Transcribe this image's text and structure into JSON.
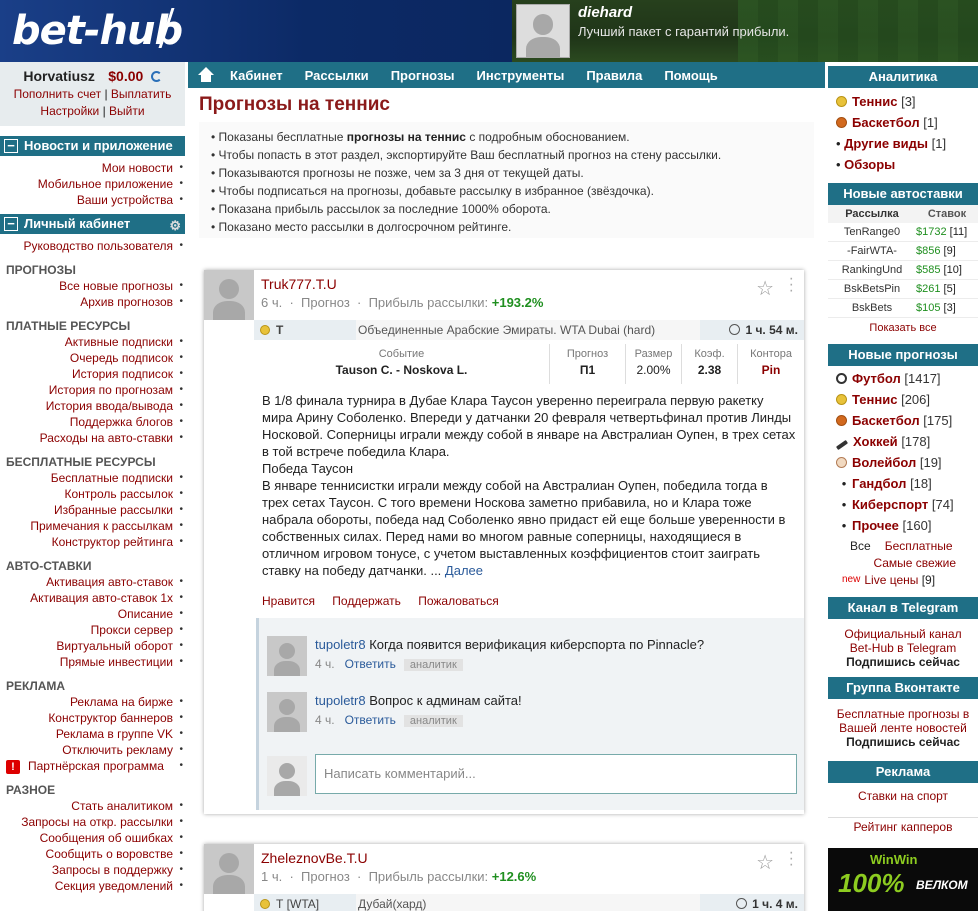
{
  "header": {
    "logo": "bet-hub",
    "promo_user": "diehard",
    "promo_slogan": "Лучший пакет с гарантий прибыли."
  },
  "account": {
    "username": "Horvatiusz",
    "balance": "$0.00",
    "links": [
      "Пополнить счет",
      "Выплатить",
      "Настройки",
      "Выйти"
    ]
  },
  "left": {
    "news_header": "Новости и приложение",
    "news_items": [
      "Мои новости",
      "Мобильное приложение",
      "Ваши устройства"
    ],
    "cabinet_header": "Личный кабинет",
    "guide": "Руководство пользователя",
    "sections": [
      {
        "title": "ПРОГНОЗЫ",
        "items": [
          "Все новые прогнозы",
          "Архив прогнозов"
        ]
      },
      {
        "title": "ПЛАТНЫЕ РЕСУРСЫ",
        "items": [
          "Активные подписки",
          "Очередь подписок",
          "История подписок",
          "История по прогнозам",
          "История ввода/вывода",
          "Поддержка блогов",
          "Расходы на авто-ставки"
        ]
      },
      {
        "title": "БЕСПЛАТНЫЕ РЕСУРСЫ",
        "items": [
          "Бесплатные подписки",
          "Контроль рассылок",
          "Избранные рассылки",
          "Примечания к рассылкам",
          "Конструктор рейтинга"
        ]
      },
      {
        "title": "АВТО-СТАВКИ",
        "items": [
          "Активация авто-ставок",
          "Активация авто-ставок 1х",
          "Описание",
          "Прокси сервер",
          "Виртуальный оборот",
          "Прямые инвестиции"
        ]
      },
      {
        "title": "РЕКЛАМА",
        "items": [
          "Реклама на бирже",
          "Конструктор баннеров",
          "Реклама в группе VK",
          "Отключить рекламу"
        ],
        "special": "Партнёрская программа"
      },
      {
        "title": "РАЗНОЕ",
        "items": [
          "Стать аналитиком",
          "Запросы на откр. рассылки",
          "Сообщения об ошибках",
          "Сообщить о воровстве",
          "Запросы в поддержку",
          "Секция уведомлений"
        ]
      }
    ]
  },
  "nav": [
    "Кабинет",
    "Рассылки",
    "Прогнозы",
    "Инструменты",
    "Правила",
    "Помощь"
  ],
  "page_title": "Прогнозы на теннис",
  "info": {
    "line1_pre": "Показаны бесплатные ",
    "line1_bold": "прогнозы на теннис",
    "line1_post": " с подробным обоснованием.",
    "lines": [
      "Чтобы попасть в этот раздел, экспортируйте Ваш бесплатный прогноз на стену рассылки.",
      "Показываются прогнозы не позже, чем за 3 дня от текущей даты.",
      "Чтобы подписаться на прогнозы, добавьте рассылку в избранное (звёздочка).",
      "Показана прибыль рассылок за последние 1000% оборота.",
      "Показано место рассылки в долгосрочном рейтинге."
    ]
  },
  "posts": [
    {
      "author": "Truk777.T.U",
      "age": "6 ч.",
      "kind": "Прогноз",
      "profit_label": "Прибыль рассылки:",
      "profit": "+193.2%",
      "sport": "Т",
      "tournament": "Объединенные Арабские Эмираты. WTA Dubai (hard)",
      "time_left": "1 ч. 54 м.",
      "bet": {
        "event_label": "Событие",
        "event": "Tauson C. - Noskova L.",
        "pick_label": "Прогноз",
        "pick": "П1",
        "size_label": "Размер",
        "size": "2.00%",
        "odds_label": "Коэф.",
        "odds": "2.38",
        "book_label": "Контора",
        "book": "Pin"
      },
      "text": [
        "В 1/8 финала турнира в Дубае Клара Таусон уверенно переиграла первую ракетку мира Арину Соболенко. Впереди у датчанки 20 февраля четвертьфинал против Линды Носковой. Соперницы играли между собой в январе на Австралиан Оупен, в трех сетах в той встрече победила Клара.",
        "Победа Таусон",
        "В январе теннисистки играли между собой на Австралиан Оупен, победила тогда в трех сетах Таусон. С того времени Носкова заметно прибавила, но и Клара тоже набрала обороты, победа над Соболенко явно придаст ей еще больше уверенности в собственных силах. Перед нами во многом равные соперницы, находящиеся в отличном игровом тонусе, с учетом выставленных коэффициентов стоит заиграть ставку на победу датчанки. ..."
      ],
      "more": "Далее",
      "actions": [
        "Нравится",
        "Поддержать",
        "Пожаловаться"
      ],
      "comments": [
        {
          "user": "tupoletr8",
          "text": "Когда появится верификация киберспорта по Pinnacle?",
          "age": "4 ч.",
          "reply": "Ответить",
          "tag": "аналитик"
        },
        {
          "user": "tupoletr8",
          "text": "Вопрос к админам сайта!",
          "age": "4 ч.",
          "reply": "Ответить",
          "tag": "аналитик"
        }
      ],
      "comment_placeholder": "Написать комментарий..."
    },
    {
      "author": "ZheleznovBe.T.U",
      "age": "1 ч.",
      "kind": "Прогноз",
      "profit_label": "Прибыль рассылки:",
      "profit": "+12.6%",
      "sport": "Т [WTA]",
      "tournament": "Дубай(хард)",
      "time_left": "1 ч. 4 м."
    }
  ],
  "right": {
    "analytics_header": "Аналитика",
    "analytics": [
      {
        "name": "Теннис",
        "count": "[3]",
        "color": "#e8c23a"
      },
      {
        "name": "Баскетбол",
        "count": "[1]",
        "color": "#d2691e"
      },
      {
        "name": "Другие виды",
        "count": "[1]",
        "color": ""
      },
      {
        "name": "Обзоры",
        "count": "",
        "color": ""
      }
    ],
    "auto_header": "Новые автоставки",
    "auto_cols": [
      "Рассылка",
      "Ставок"
    ],
    "auto_rows": [
      {
        "name": "TenRange0",
        "amt": "$1732",
        "n": "[11]"
      },
      {
        "name": "-FairWTA-",
        "amt": "$856",
        "n": "[9]"
      },
      {
        "name": "RankingUnd",
        "amt": "$585",
        "n": "[10]"
      },
      {
        "name": "BskBetsPin",
        "amt": "$261",
        "n": "[5]"
      },
      {
        "name": "BskBets",
        "amt": "$105",
        "n": "[3]"
      }
    ],
    "auto_all": "Показать все",
    "new_header": "Новые прогнозы",
    "new_sports": [
      {
        "name": "Футбол",
        "count": "[1417]"
      },
      {
        "name": "Теннис",
        "count": "[206]"
      },
      {
        "name": "Баскетбол",
        "count": "[175]"
      },
      {
        "name": "Хоккей",
        "count": "[178]"
      },
      {
        "name": "Волейбол",
        "count": "[19]"
      },
      {
        "name": "Гандбол",
        "count": "[18]"
      },
      {
        "name": "Киберспорт",
        "count": "[74]"
      },
      {
        "name": "Прочее",
        "count": "[160]"
      }
    ],
    "filter_all": "Все",
    "filter_free": "Бесплатные",
    "filter_fresh": "Самые свежие",
    "new_badge": "new",
    "live": "Live цены",
    "live_count": "[9]",
    "tg_header": "Канал в Telegram",
    "tg_text": "Официальный канал Bet-Hub в Telegram",
    "tg_sub": "Подпишись сейчас",
    "vk_header": "Группа Вконтакте",
    "vk_text": "Бесплатные прогнозы в Вашей ленте новостей",
    "vk_sub": "Подпишись сейчас",
    "ad_header": "Реклама",
    "ad_link": "Ставки на спорт",
    "rating_link": "Рейтинг капперов",
    "banner_brand": "WinWin",
    "banner_big": "100%",
    "banner_small": "ВЕЛКОМ"
  }
}
